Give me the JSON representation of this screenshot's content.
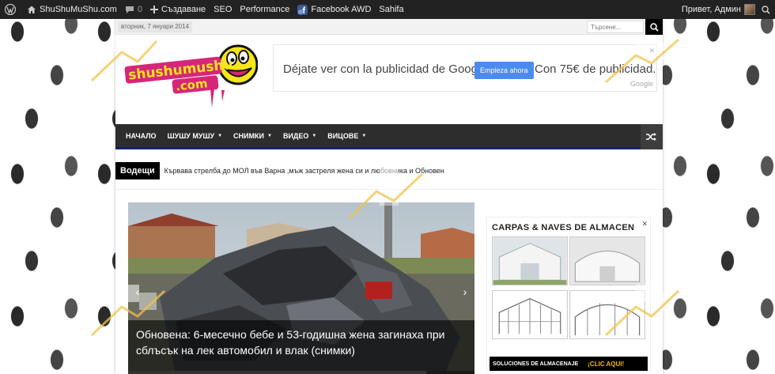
{
  "adminbar": {
    "site_name": "ShuShuMuShu.com",
    "comments_count": "0",
    "new_label": "Създаване",
    "seo_label": "SEO",
    "performance_label": "Performance",
    "facebook_label": "Facebook AWD",
    "sahifa_label": "Sahifa",
    "greeting": "Привет, Админ"
  },
  "topstrip": {
    "date": "вторник, 7 януари 2014",
    "search_placeholder": "Търсене..."
  },
  "logo": {
    "line1": "shushumushu",
    "line2": ".com"
  },
  "header_ad": {
    "text": "Déjate ver con la publicidad de Google.",
    "button": "Empieza ahora",
    "text2": "Con 75€ de publicidad.",
    "brand": "Google"
  },
  "nav": {
    "items": [
      {
        "label": "НАЧАЛО",
        "caret": false
      },
      {
        "label": "ШУШУ МУШУ",
        "caret": true
      },
      {
        "label": "СНИМКИ",
        "caret": true
      },
      {
        "label": "ВИДЕО",
        "caret": true
      },
      {
        "label": "ВИЦОВЕ",
        "caret": true
      }
    ]
  },
  "ticker": {
    "label": "Водещи",
    "text": "Кървава стрелба до МОЛ във Варна ,мъж застреля жена си и любовника и Обновен"
  },
  "slider": {
    "caption_line1": "Обновена: 6-месечно бебе и 53-годишна жена загинаха при",
    "caption_line2": "сблъсък на лек автомобил и влак (снимки)",
    "progress": 0.86
  },
  "side_ad": {
    "title": "CARPAS & NAVES DE ALMACEN",
    "footer_left": "SOLUCIONES DE ALMACENAJE",
    "footer_right": "¡CLIC AQUI!"
  },
  "colors": {
    "adminbar": "#222222",
    "nav": "#2d2d2d",
    "nav_underline": "#16216b",
    "ad_button": "#4b8bef",
    "logo_pink": "#d6267a",
    "logo_yellow": "#f5e51b",
    "side_ad_cta": "#f2b705"
  },
  "icons": {
    "wordpress": "wordpress-icon",
    "home": "home-icon",
    "comments": "comment-icon",
    "new": "plus-icon",
    "facebook": "facebook-icon",
    "search": "search-icon",
    "random": "shuffle-icon",
    "close": "close-icon"
  }
}
